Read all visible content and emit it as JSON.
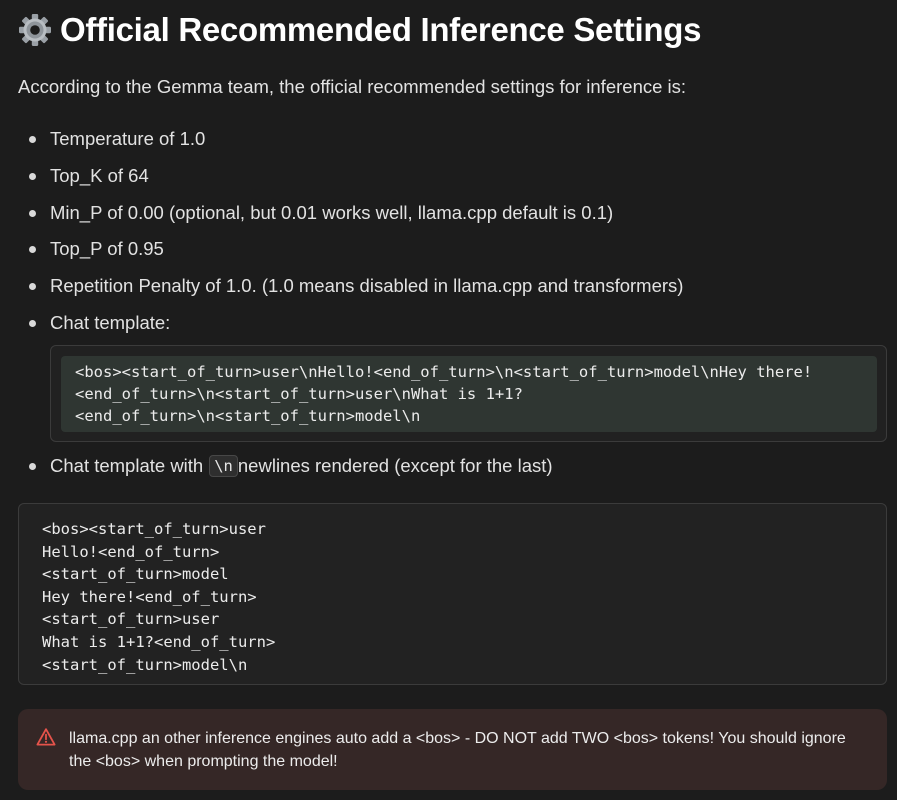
{
  "heading": {
    "icon": "gear-icon",
    "title": "Official Recommended Inference Settings"
  },
  "intro": "According to the Gemma team, the official recommended settings for inference is:",
  "settings": [
    "Temperature of 1.0",
    "Top_K of 64",
    "Min_P of 0.00 (optional, but 0.01 works well, llama.cpp default is 0.1)",
    "Top_P of 0.95",
    "Repetition Penalty of 1.0. (1.0 means disabled in llama.cpp and transformers)",
    "Chat template:"
  ],
  "chat_template_code": "<bos><start_of_turn>user\\nHello!<end_of_turn>\\n<start_of_turn>model\\nHey there!\n<end_of_turn>\\n<start_of_turn>user\\nWhat is 1+1?\n<end_of_turn>\\n<start_of_turn>model\\n",
  "newline_bullet": {
    "before": "Chat template with",
    "code": "\\n",
    "after": "newlines rendered (except for the last)"
  },
  "rendered_template_code": "<bos><start_of_turn>user\nHello!<end_of_turn>\n<start_of_turn>model\nHey there!<end_of_turn>\n<start_of_turn>user\nWhat is 1+1?<end_of_turn>\n<start_of_turn>model\\n",
  "warning": {
    "icon": "warning-triangle-icon",
    "text": "llama.cpp an other inference engines auto add a <bos> - DO NOT add TWO <bos> tokens! You should ignore the <bos> when prompting the model!"
  },
  "colors": {
    "background": "#1c1c1c",
    "code_inner": "#2f3632",
    "warning_bg": "#352726",
    "warning_icon": "#e5534b"
  }
}
